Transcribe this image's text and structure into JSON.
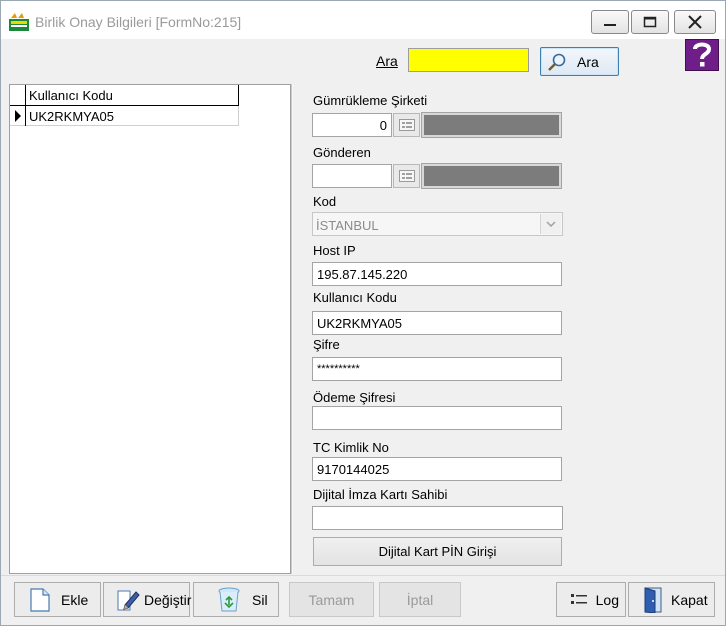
{
  "window": {
    "title": "Birlik Onay Bilgileri [FormNo:215]"
  },
  "search": {
    "label": "Ara",
    "value": "",
    "button_label": "Ara"
  },
  "grid": {
    "column_header": "Kullanıcı Kodu",
    "rows": [
      {
        "kullanici_kodu": "UK2RKMYA05"
      }
    ]
  },
  "form": {
    "gumrukleme_sirketi": {
      "label": "Gümrükleme Şirketi",
      "value": "0"
    },
    "gonderen": {
      "label": "Gönderen",
      "value": ""
    },
    "kod": {
      "label": "Kod",
      "value": "İSTANBUL"
    },
    "host_ip": {
      "label": "Host IP",
      "value": "195.87.145.220"
    },
    "kullanici_kodu": {
      "label": "Kullanıcı Kodu",
      "value": "UK2RKMYA05"
    },
    "sifre": {
      "label": "Şifre",
      "value": "**********"
    },
    "odeme_sifresi": {
      "label": "Ödeme Şifresi",
      "value": ""
    },
    "tc_kimlik_no": {
      "label": "TC Kimlik No",
      "value": "9170144025"
    },
    "dijital_imza": {
      "label": "Dijital İmza Kartı Sahibi",
      "value": ""
    },
    "pin_button_label": "Dijital Kart PİN Girişi"
  },
  "toolbar": {
    "ekle": "Ekle",
    "degistir": "Değiştir",
    "sil": "Sil",
    "tamam": "Tamam",
    "iptal": "İptal",
    "log": "Log",
    "kapat": "Kapat"
  },
  "colors": {
    "search_highlight": "#ffff00",
    "help_icon_bg": "#6f1d89",
    "lookup_display": "#7c7c7c"
  }
}
